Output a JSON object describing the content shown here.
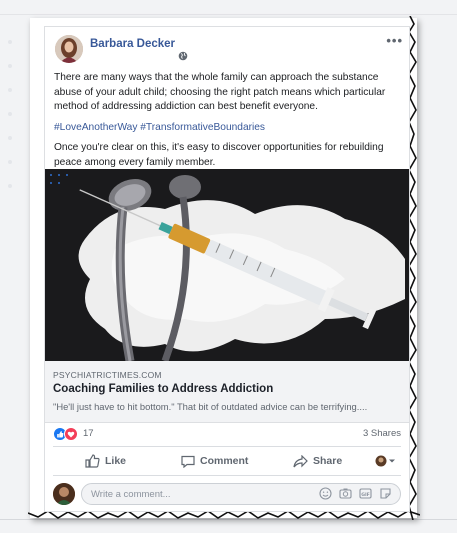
{
  "post": {
    "author_name": "Barbara Decker",
    "more_label": "•••",
    "paragraph1": "There are many ways that the whole family can approach the substance abuse of your adult child; choosing the right patch means which particular method of addressing addiction can best benefit everyone.",
    "hashtags": "#LoveAnotherWay #TransformativeBoundaries",
    "paragraph3": "Once you're clear on this, it's easy to discover opportunities for rebuilding peace among every family member."
  },
  "link": {
    "domain": "PSYCHIATRICTIMES.COM",
    "title": "Coaching Families to Address Addiction",
    "description": "\"He'll just have to hit bottom.\" That bit of outdated advice can be terrifying...."
  },
  "engagement": {
    "reaction_count": "17",
    "shares": "3 Shares"
  },
  "actions": {
    "like": "Like",
    "comment": "Comment",
    "share": "Share"
  },
  "comment": {
    "placeholder": "Write a comment..."
  },
  "colors": {
    "author_link": "#385898",
    "like_blue": "#1877f2",
    "love_red": "#f33e58",
    "secondary_text": "#606770"
  }
}
